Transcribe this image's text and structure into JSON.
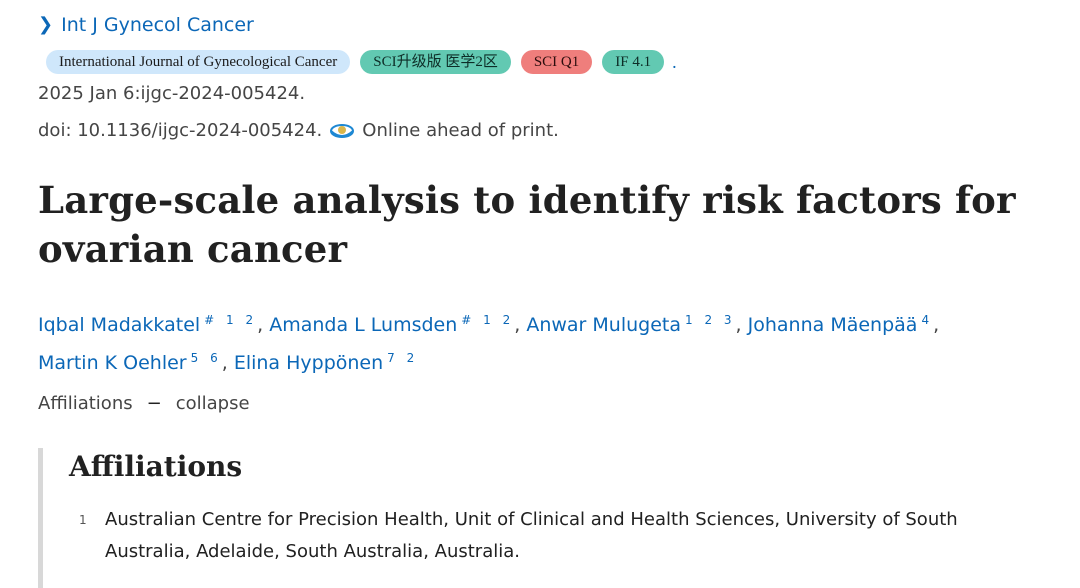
{
  "journal": {
    "link_label": "Int J Gynecol Cancer"
  },
  "badges": {
    "journal_full": "International Journal of Gynecological Cancer",
    "sci_class": "SCI升级版 医学2区",
    "sci_q": "SCI Q1",
    "impact": "IF 4.1",
    "trailing_dot": "."
  },
  "citation": {
    "date_line": "2025 Jan 6:ijgc-2024-005424.",
    "doi": "doi: 10.1136/ijgc-2024-005424.",
    "status": "Online ahead of print."
  },
  "article": {
    "title_line1": "Large-scale analysis to identify risk factors for",
    "title_line2": "ovarian cancer"
  },
  "authors": [
    {
      "name": "Iqbal Madakkatel",
      "marks": "# 1 2",
      "sep": ", "
    },
    {
      "name": "Amanda L Lumsden",
      "marks": "# 1 2",
      "sep": ", "
    },
    {
      "name": "Anwar Mulugeta",
      "marks": "1 2 3",
      "sep": ", "
    },
    {
      "name": "Johanna Mäenpää",
      "marks": "4",
      "sep": ","
    },
    {
      "name": "Martin K Oehler",
      "marks": "5 6",
      "sep": ", "
    },
    {
      "name": "Elina Hyppönen",
      "marks": "7 2",
      "sep": ""
    }
  ],
  "affiliations_toggle": {
    "label": "Affiliations",
    "action": "collapse"
  },
  "affiliations": {
    "heading": "Affiliations",
    "items": [
      {
        "num": "1",
        "text": "Australian Centre for Precision Health, Unit of Clinical and Health Sciences, University of South Australia, Adelaide, South Australia, Australia."
      }
    ]
  },
  "colors": {
    "link": "#0b67b7",
    "badge_blue": "#cfe7fb",
    "badge_green": "#62c9b2",
    "badge_red": "#ef7e7c"
  },
  "icons": {
    "journal_chevron": "chevron-right-icon",
    "review_status": "eye-icon"
  }
}
